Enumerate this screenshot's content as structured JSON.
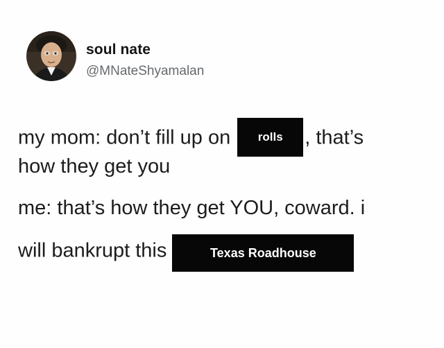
{
  "profile": {
    "display_name": "soul nate",
    "handle": "@MNateShyamalan",
    "avatar_icon": "avatar-portrait"
  },
  "tweet": {
    "line1_before": "my mom: don’t fill up on",
    "line1_redacted": "rolls",
    "line1_after": ", that’s",
    "line2": "how they get you",
    "line3": "me: that’s how they get YOU, coward. i",
    "line4_before": "will bankrupt this",
    "line4_redacted": "Texas Roadhouse"
  },
  "colors": {
    "text": "#1c1c1c",
    "handle": "#666a6e",
    "redaction_box": "#070707"
  }
}
